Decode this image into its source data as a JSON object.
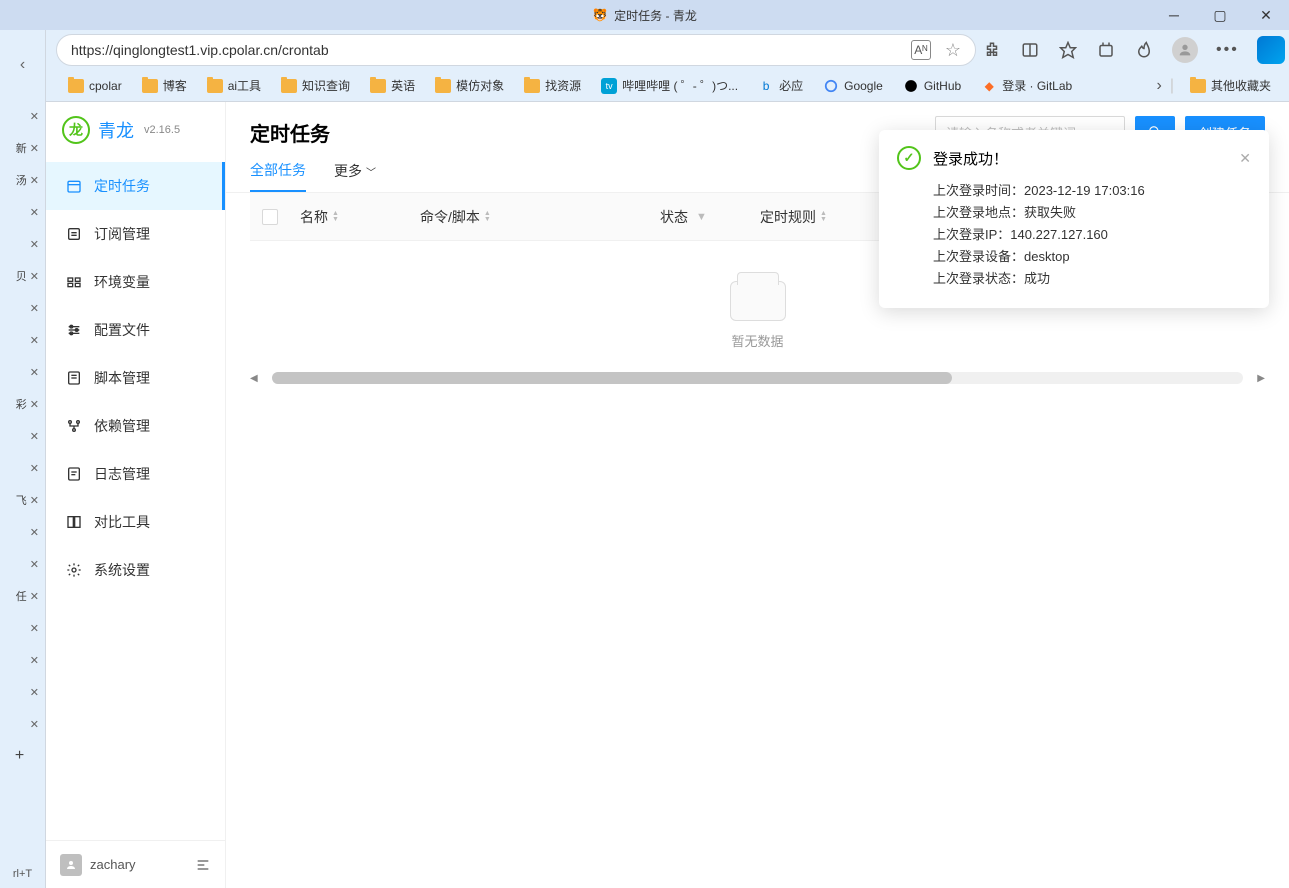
{
  "titlebar": {
    "title": "定时任务 - 青龙"
  },
  "address": {
    "url": "https://qinglongtest1.vip.cpolar.cn/crontab"
  },
  "bookmarks": {
    "items": [
      {
        "label": "cpolar",
        "type": "folder"
      },
      {
        "label": "博客",
        "type": "folder"
      },
      {
        "label": "ai工具",
        "type": "folder"
      },
      {
        "label": "知识查询",
        "type": "folder"
      },
      {
        "label": "英语",
        "type": "folder"
      },
      {
        "label": "模仿对象",
        "type": "folder"
      },
      {
        "label": "找资源",
        "type": "folder"
      },
      {
        "label": "哔哩哔哩 (  ゜- ゜)つ...",
        "type": "site-bili"
      },
      {
        "label": "必应",
        "type": "site-bing"
      },
      {
        "label": "Google",
        "type": "site-google"
      },
      {
        "label": "GitHub",
        "type": "site-github"
      },
      {
        "label": "登录 · GitLab",
        "type": "site-gitlab"
      }
    ],
    "overflow": "其他收藏夹"
  },
  "app": {
    "name": "青龙",
    "version": "v2.16.5",
    "user": "zachary"
  },
  "sidebar": {
    "items": [
      {
        "label": "定时任务"
      },
      {
        "label": "订阅管理"
      },
      {
        "label": "环境变量"
      },
      {
        "label": "配置文件"
      },
      {
        "label": "脚本管理"
      },
      {
        "label": "依赖管理"
      },
      {
        "label": "日志管理"
      },
      {
        "label": "对比工具"
      },
      {
        "label": "系统设置"
      }
    ]
  },
  "page": {
    "title": "定时任务",
    "search_placeholder": "请输入名称或者关键词",
    "create_label": "创建任务",
    "tabs": {
      "all": "全部任务",
      "more": "更多"
    },
    "columns": {
      "name": "名称",
      "cmd": "命令/脚本",
      "status": "状态",
      "cron": "定时规则"
    },
    "empty": "暂无数据"
  },
  "notification": {
    "title": "登录成功！",
    "time_label": "上次登录时间：",
    "time_value": "2023-12-19 17:03:16",
    "loc_label": "上次登录地点：",
    "loc_value": "获取失败",
    "ip_label": "上次登录IP：",
    "ip_value": "140.227.127.160",
    "device_label": "上次登录设备：",
    "device_value": "desktop",
    "status_label": "上次登录状态：",
    "status_value": "成功"
  },
  "edge_shortcut": "rl+T"
}
